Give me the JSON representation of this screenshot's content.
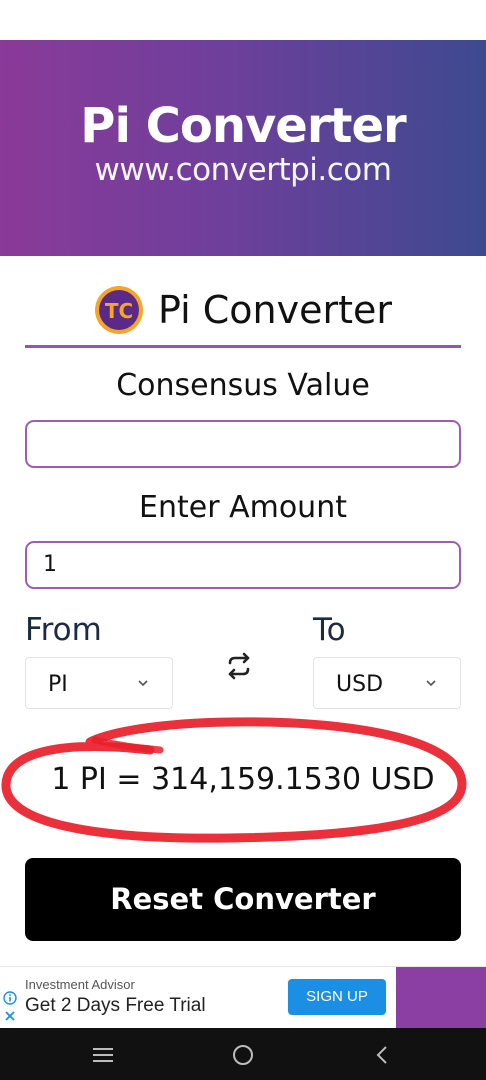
{
  "banner": {
    "title": "Pi Converter",
    "url": "www.convertpi.com"
  },
  "header": {
    "logo_text": "TC",
    "title": "Pi Converter"
  },
  "form": {
    "consensus_label": "Consensus Value",
    "consensus_value": "",
    "amount_label": "Enter Amount",
    "amount_value": "1",
    "from_label": "From",
    "from_value": "PI",
    "to_label": "To",
    "to_value": "USD"
  },
  "result": {
    "text": "1 PI = 314,159.1530 USD"
  },
  "reset_button": {
    "label": "Reset Converter"
  },
  "ad": {
    "eyebrow": "Investment Advisor",
    "headline": "Get 2 Days Free Trial",
    "cta": "SIGN UP"
  },
  "icons": {
    "logo": "pi-coin-logo-icon",
    "swap": "swap-arrows-icon",
    "chevron": "chevron-down-icon",
    "info": "info-icon",
    "close": "close-icon",
    "nav_menu": "menu-lines-icon",
    "nav_home": "home-circle-icon",
    "nav_back": "back-chevron-icon"
  },
  "colors": {
    "brand_purple": "#8a3a98",
    "brand_blue": "#3d4a8f",
    "accent_border": "#9a5fb0",
    "annotation_red": "#e8202a",
    "signup_blue": "#1a8fe3"
  }
}
